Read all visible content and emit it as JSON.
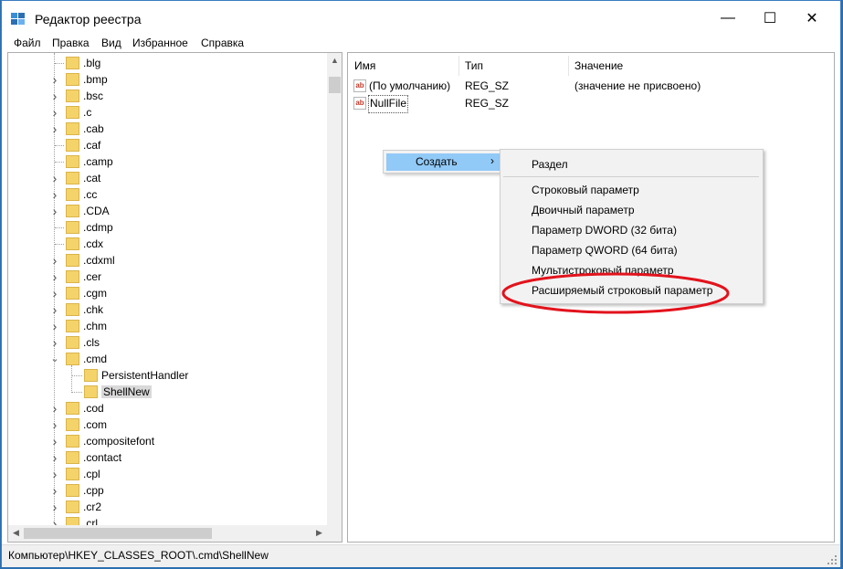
{
  "window": {
    "title": "Редактор реестра",
    "minimize": "—",
    "maximize": "☐",
    "close": "✕"
  },
  "menu": [
    "Файл",
    "Правка",
    "Вид",
    "Избранное",
    "Справка"
  ],
  "tree": {
    "items": [
      {
        "label": ".blg",
        "expander": "none"
      },
      {
        "label": ".bmp",
        "expander": "collapsed"
      },
      {
        "label": ".bsc",
        "expander": "collapsed"
      },
      {
        "label": ".c",
        "expander": "collapsed"
      },
      {
        "label": ".cab",
        "expander": "collapsed"
      },
      {
        "label": ".caf",
        "expander": "none"
      },
      {
        "label": ".camp",
        "expander": "none"
      },
      {
        "label": ".cat",
        "expander": "collapsed"
      },
      {
        "label": ".cc",
        "expander": "collapsed"
      },
      {
        "label": ".CDA",
        "expander": "collapsed"
      },
      {
        "label": ".cdmp",
        "expander": "none"
      },
      {
        "label": ".cdx",
        "expander": "none"
      },
      {
        "label": ".cdxml",
        "expander": "collapsed"
      },
      {
        "label": ".cer",
        "expander": "collapsed"
      },
      {
        "label": ".cgm",
        "expander": "collapsed"
      },
      {
        "label": ".chk",
        "expander": "collapsed"
      },
      {
        "label": ".chm",
        "expander": "collapsed"
      },
      {
        "label": ".cls",
        "expander": "collapsed"
      },
      {
        "label": ".cmd",
        "expander": "expanded"
      },
      {
        "label": "PersistentHandler",
        "expander": "none",
        "child": true
      },
      {
        "label": "ShellNew",
        "expander": "none",
        "child": true,
        "selected": true
      },
      {
        "label": ".cod",
        "expander": "collapsed"
      },
      {
        "label": ".com",
        "expander": "collapsed"
      },
      {
        "label": ".compositefont",
        "expander": "collapsed"
      },
      {
        "label": ".contact",
        "expander": "collapsed"
      },
      {
        "label": ".cpl",
        "expander": "collapsed"
      },
      {
        "label": ".cpp",
        "expander": "collapsed"
      },
      {
        "label": ".cr2",
        "expander": "collapsed"
      },
      {
        "label": ".crl",
        "expander": "collapsed"
      }
    ]
  },
  "values": {
    "columns": {
      "name": "Имя",
      "type": "Тип",
      "value": "Значение"
    },
    "rows": [
      {
        "name": "(По умолчанию)",
        "type": "REG_SZ",
        "value": "(значение не присвоено)",
        "icon": "ab"
      },
      {
        "name": "NullFile",
        "type": "REG_SZ",
        "value": "",
        "icon": "ab"
      }
    ]
  },
  "context_menu": {
    "create_label": "Создать",
    "arrow": "›"
  },
  "submenu": {
    "section": "Раздел",
    "items": [
      "Строковый параметр",
      "Двоичный параметр",
      "Параметр DWORD (32 бита)",
      "Параметр QWORD (64 бита)",
      "Мультистроковый параметр",
      "Расширяемый строковый параметр"
    ]
  },
  "statusbar": {
    "path": "Компьютер\\HKEY_CLASSES_ROOT\\.cmd\\ShellNew"
  },
  "colors": {
    "highlight": "#91c9f7",
    "annotation": "#e2131c",
    "folder": "#f5d36b",
    "frame": "#3a7cc0"
  },
  "icons": [
    "registry-editor-icon",
    "folder-icon",
    "string-value-icon",
    "chevron-right-icon",
    "chevron-down-icon",
    "size-grip-icon"
  ]
}
